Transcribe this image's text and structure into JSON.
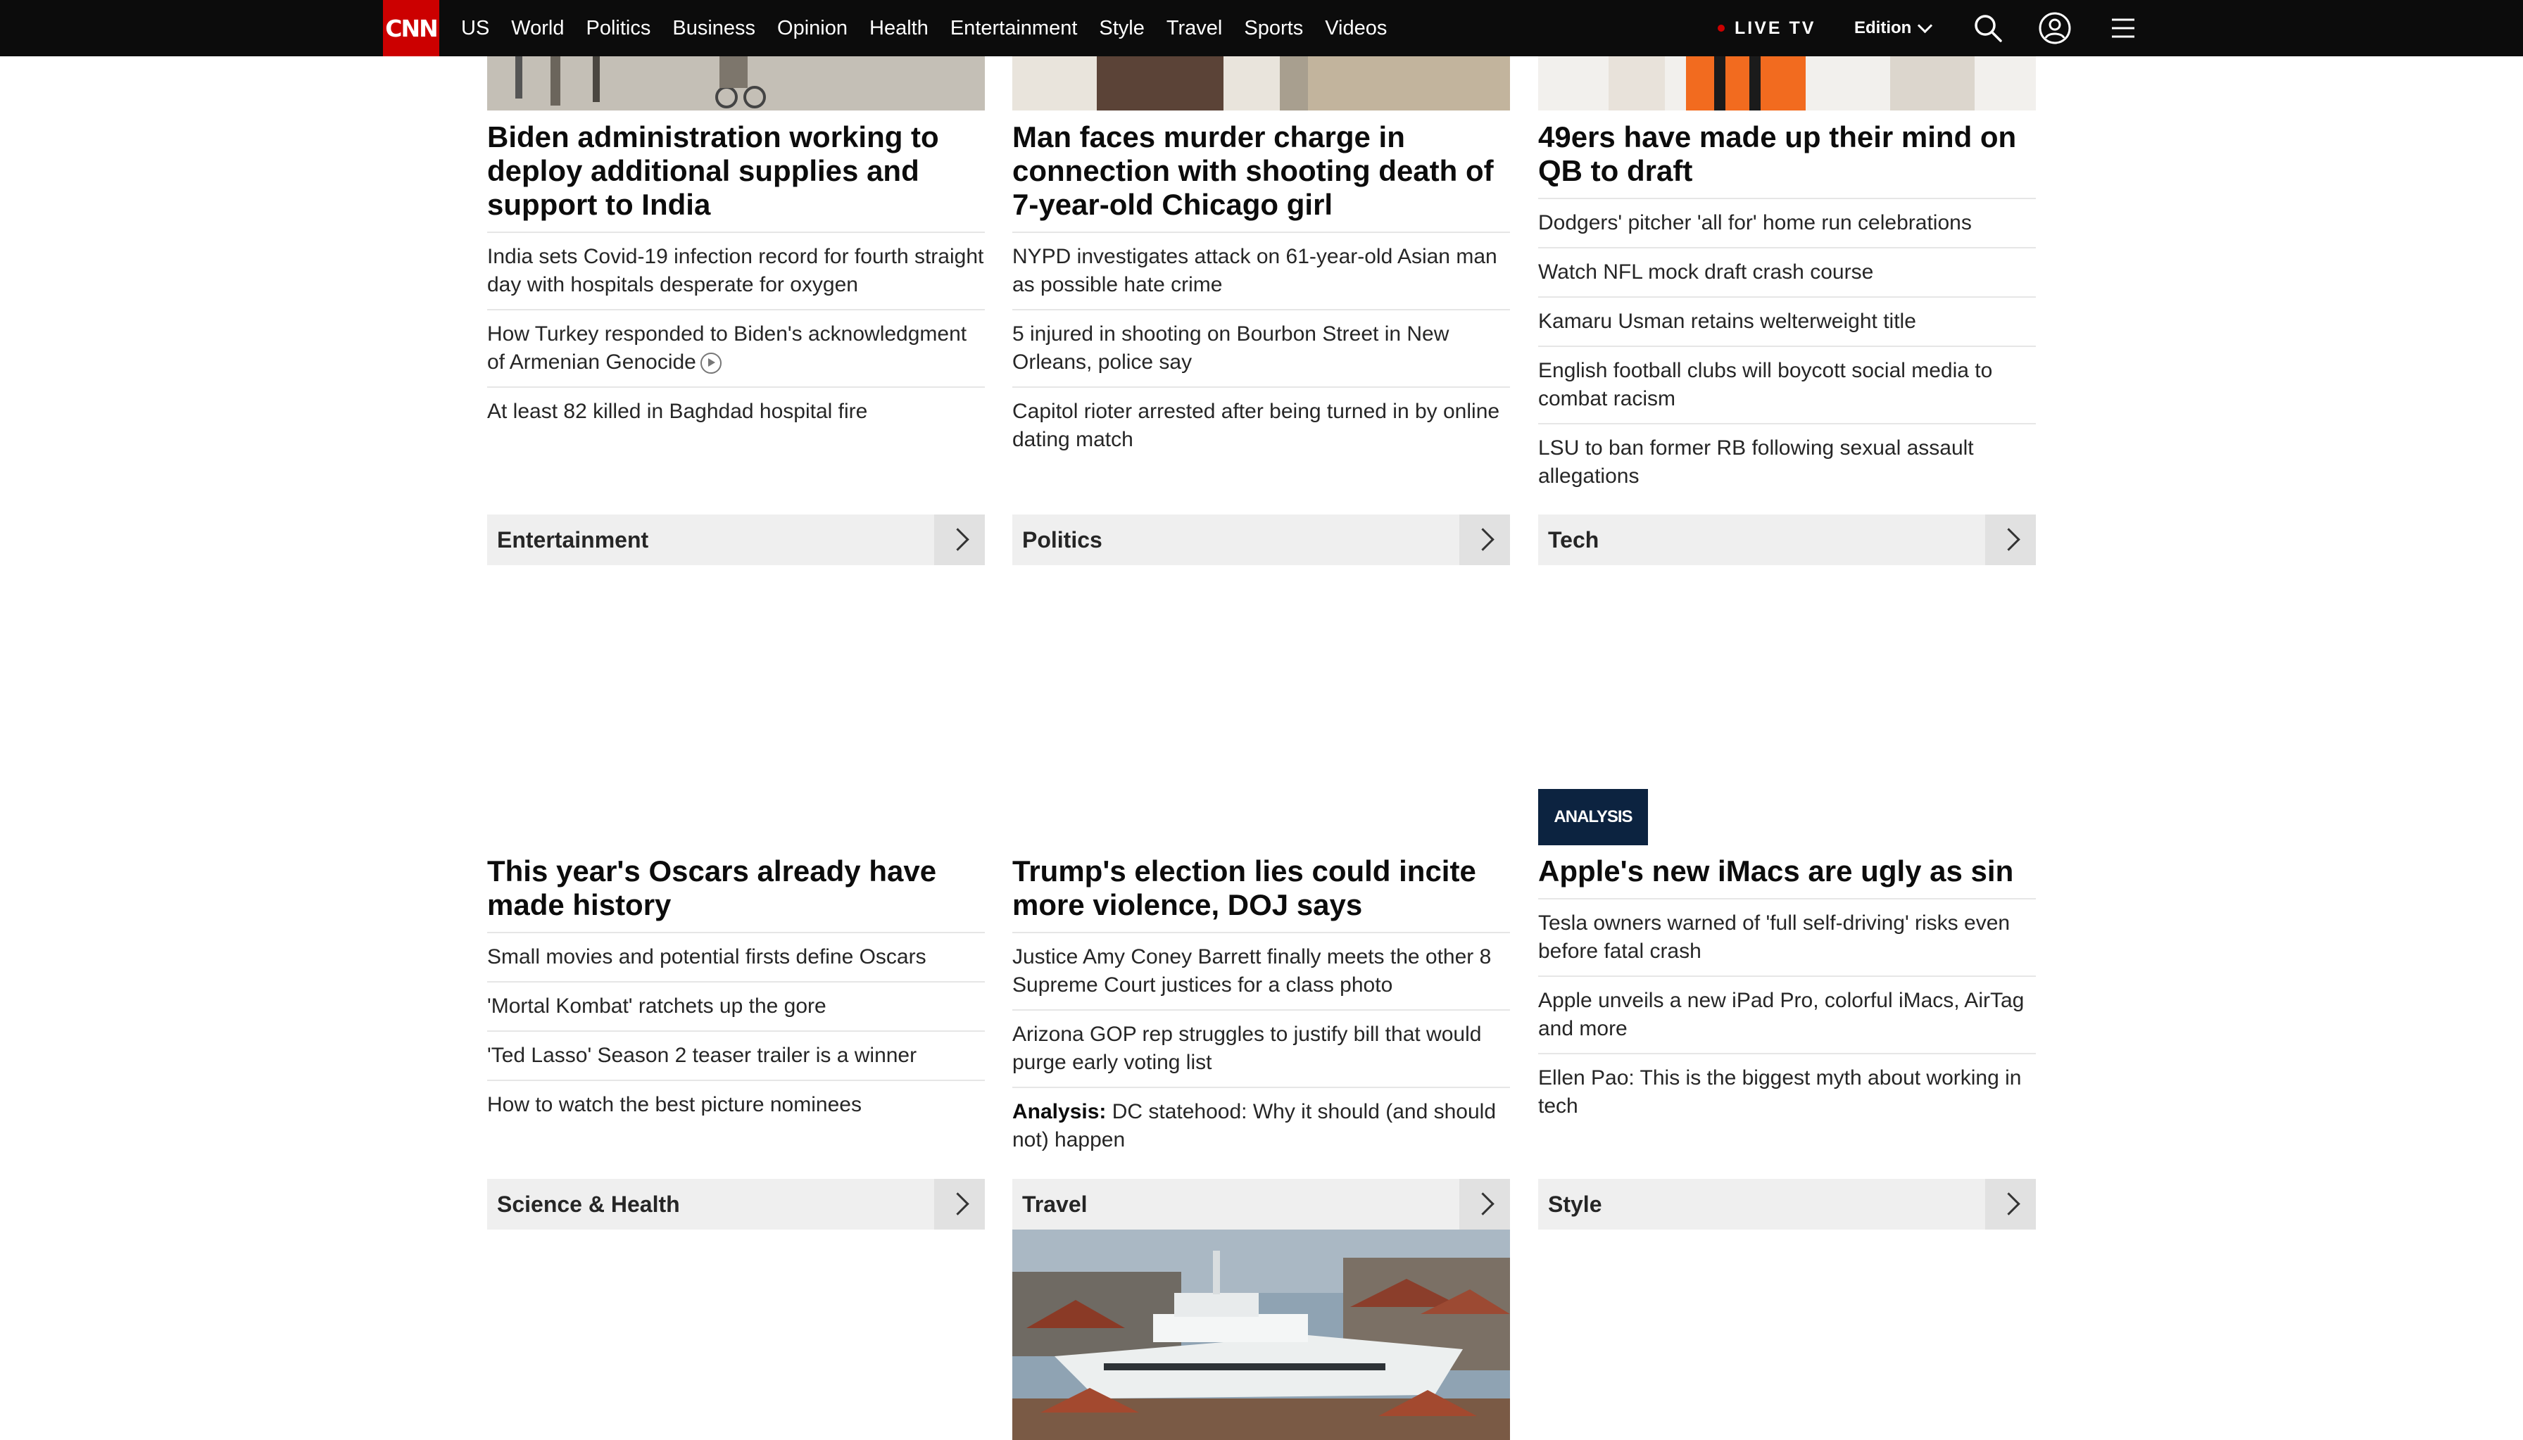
{
  "nav": {
    "logo": "CNN",
    "links": [
      "US",
      "World",
      "Politics",
      "Business",
      "Opinion",
      "Health",
      "Entertainment",
      "Style",
      "Travel",
      "Sports",
      "Videos"
    ],
    "live_tv": "LIVE TV",
    "edition": "Edition"
  },
  "col1_top": {
    "headline": "Biden administration working to deploy additional supplies and support to India",
    "items": [
      "India sets Covid-19 infection record for fourth straight day with hospitals desperate for oxygen",
      "How Turkey responded to Biden's acknowledgment of Armenian Genocide",
      "At least 82 killed in Baghdad hospital fire"
    ]
  },
  "col2_top": {
    "headline": "Man faces murder charge in connection with shooting death of 7-year-old Chicago girl",
    "items": [
      "NYPD investigates attack on 61-year-old Asian man as possible hate crime",
      "5 injured in shooting on Bourbon Street in New Orleans, police say",
      "Capitol rioter arrested after being turned in by online dating match"
    ]
  },
  "col3_top": {
    "headline": "49ers have made up their mind on QB to draft",
    "items": [
      "Dodgers' pitcher 'all for' home run celebrations",
      "Watch NFL mock draft crash course",
      "Kamaru Usman retains welterweight title",
      "English football clubs will boycott social media to combat racism",
      "LSU to ban former RB following sexual assault allegations"
    ]
  },
  "sections_row1": [
    "Entertainment",
    "Politics",
    "Tech"
  ],
  "col1_mid": {
    "headline": "This year's Oscars already have made history",
    "items": [
      "Small movies and potential firsts define Oscars",
      "'Mortal Kombat' ratchets up the gore",
      "'Ted Lasso' Season 2 teaser trailer is a winner",
      "How to watch the best picture nominees"
    ]
  },
  "col2_mid": {
    "headline": "Trump's election lies could incite more violence, DOJ says",
    "items": [
      "Justice Amy Coney Barrett finally meets the other 8 Supreme Court justices for a class photo",
      "Arizona GOP rep struggles to justify bill that would purge early voting list"
    ],
    "analysis_prefix": "Analysis:",
    "analysis_text": " DC statehood: Why it should (and should not) happen"
  },
  "col3_mid": {
    "badge": "ANALYSIS",
    "headline": "Apple's new iMacs are ugly as sin",
    "items": [
      "Tesla owners warned of 'full self-driving' risks even before fatal crash",
      "Apple unveils a new iPad Pro, colorful iMacs, AirTag and more",
      "Ellen Pao: This is the biggest myth about working in tech"
    ]
  },
  "sections_row2": [
    "Science & Health",
    "Travel",
    "Style"
  ]
}
